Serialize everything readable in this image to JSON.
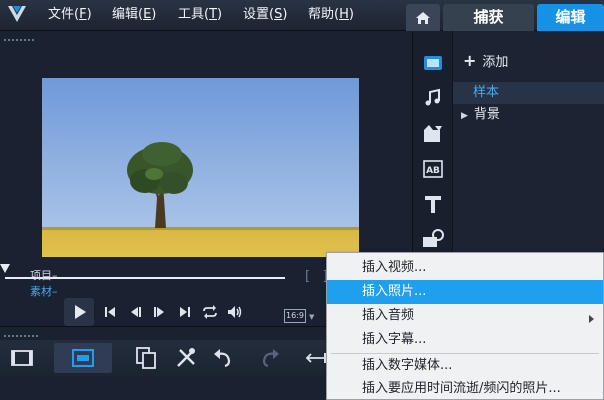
{
  "menubar": {
    "items": [
      {
        "text": "文件(",
        "key": "F",
        "end": ")"
      },
      {
        "text": "编辑(",
        "key": "E",
        "end": ")"
      },
      {
        "text": "工具(",
        "key": "T",
        "end": ")"
      },
      {
        "text": "设置(",
        "key": "S",
        "end": ")"
      },
      {
        "text": "帮助(",
        "key": "H",
        "end": ")"
      }
    ],
    "tabs": {
      "home_icon": "home-icon",
      "capture": "捕获",
      "edit": "编辑"
    }
  },
  "player": {
    "preview_image": "tree-in-field-photo",
    "mode_project": "项目",
    "mode_clip": "素材",
    "aspect_ratio": "16:9",
    "scrub_progress": 0,
    "controls": [
      "play-icon",
      "previous-icon",
      "step-back-icon",
      "step-forward-icon",
      "next-icon",
      "repeat-icon",
      "volume-icon"
    ]
  },
  "library": {
    "add_label": "添加",
    "items": [
      {
        "label": "样本",
        "selected": true
      },
      {
        "label": "背景",
        "selected": false
      }
    ],
    "icons": [
      "media-library-icon",
      "audio-icon",
      "transition-icon",
      "title-ab-icon",
      "text-t-icon",
      "graphics-icon"
    ]
  },
  "context_menu": {
    "items": [
      {
        "label": "插入视频...",
        "selected": false
      },
      {
        "label": "插入照片...",
        "selected": true
      },
      {
        "label": "插入音频",
        "selected": false,
        "submenu": true
      },
      {
        "label": "插入字幕...",
        "selected": false
      },
      {
        "label": "插入数字媒体...",
        "selected": false
      },
      {
        "label": "插入要应用时间流逝/频闪的照片...",
        "selected": false
      }
    ]
  },
  "colors": {
    "accent_tab": "#1592e6",
    "menu_selected": "#1fa0ee",
    "library_selected_text": "#4ca8f0",
    "background": "#1b2230"
  }
}
